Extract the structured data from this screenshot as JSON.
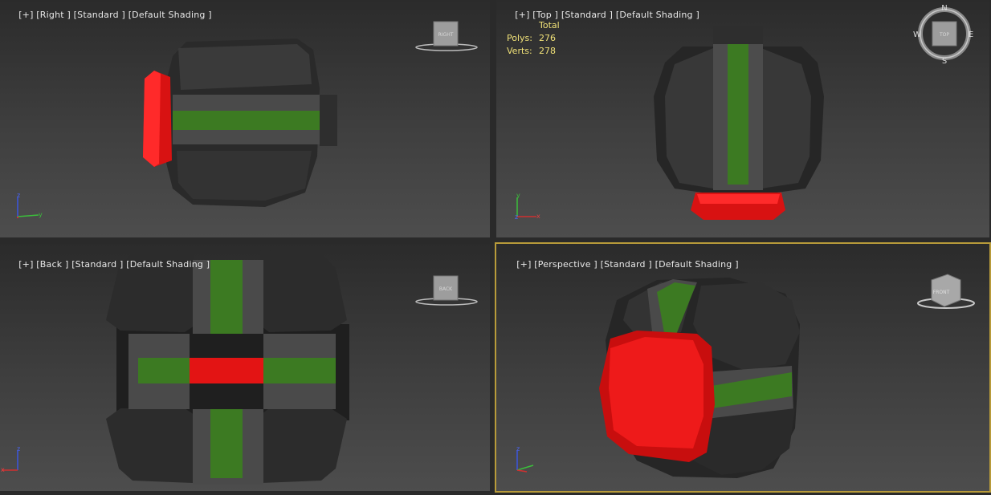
{
  "viewports": {
    "right": {
      "bracket": "[+]",
      "view": "[Right ]",
      "render": "[Standard ]",
      "shading": "[Default Shading ]",
      "viewcube": "RIGHT"
    },
    "top": {
      "bracket": "[+]",
      "view": "[Top ]",
      "render": "[Standard ]",
      "shading": "[Default Shading ]",
      "viewcube": "TOP"
    },
    "back": {
      "bracket": "[+]",
      "view": "[Back ]",
      "render": "[Standard ]",
      "shading": "[Default Shading ]",
      "viewcube": "BACK"
    },
    "perspective": {
      "bracket": "[+]",
      "view": "[Perspective ]",
      "render": "[Standard ]",
      "shading": "[Default Shading ]",
      "viewcube": "FRONT"
    }
  },
  "stats": {
    "header": "Total",
    "polys_label": "Polys:",
    "polys_value": "276",
    "verts_label": "Verts:",
    "verts_value": "278"
  },
  "compass": {
    "n": "N",
    "s": "S",
    "e": "E",
    "w": "W"
  },
  "axes": {
    "z": "z",
    "y": "y",
    "x": "x"
  },
  "colors": {
    "active_border": "#b89b3a",
    "model_red": "#e31414",
    "model_green": "#3c7a22",
    "model_dark": "#2e2e2e",
    "stats_text": "#f0e178"
  }
}
